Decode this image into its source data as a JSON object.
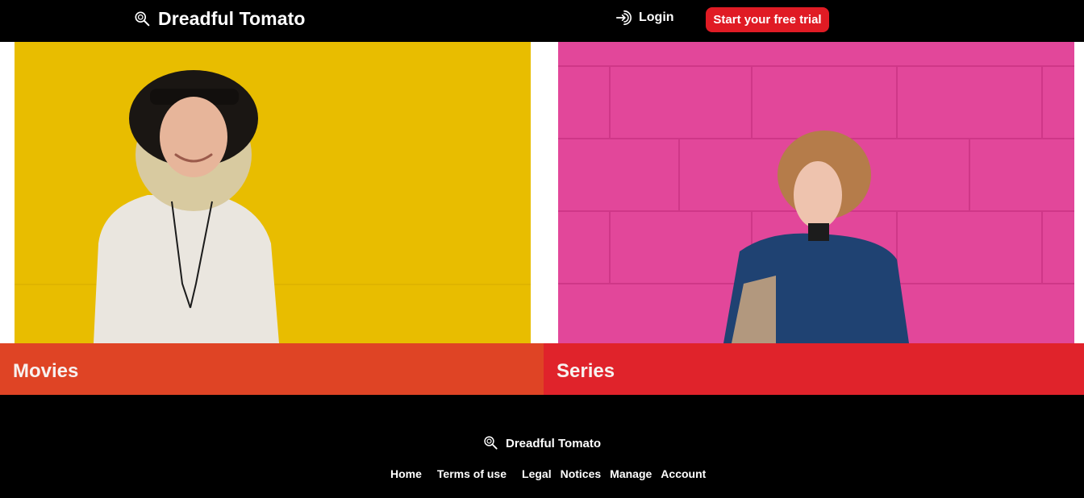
{
  "header": {
    "brand_name": "Dreadful Tomato",
    "brand_icon": "magnifier-icon",
    "login_label": "Login",
    "login_icon": "login-icon",
    "trial_button": "Start your free trial"
  },
  "cards": [
    {
      "label": "Movies",
      "band_color": "#df4425",
      "photo_background": "#f0c300"
    },
    {
      "label": "Series",
      "band_color": "#e0232b",
      "photo_background": "#e2479a"
    }
  ],
  "footer": {
    "brand_name": "Dreadful Tomato",
    "nav": [
      "Home",
      "Terms of use",
      "Legal",
      "Notices",
      "Manage",
      "Account"
    ]
  },
  "colors": {
    "header_background": "#000000",
    "accent_red": "#e01b24"
  }
}
